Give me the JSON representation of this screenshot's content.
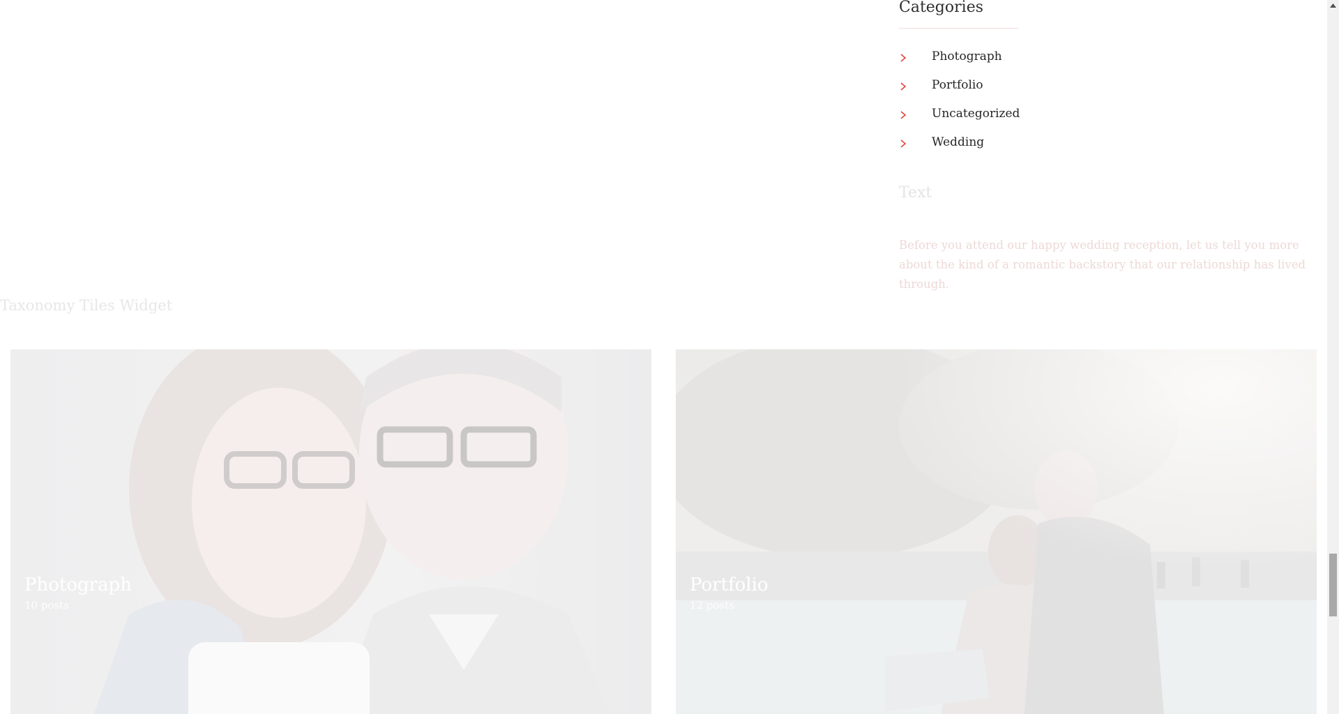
{
  "sidebar": {
    "categories_title": "Categories",
    "categories": [
      {
        "label": "Photograph"
      },
      {
        "label": "Portfolio"
      },
      {
        "label": "Uncategorized"
      },
      {
        "label": "Wedding"
      }
    ],
    "text_widget_title": "Text",
    "text_widget_body": "Before you attend our happy wedding reception, let us tell you more about the kind of a romantic backstory that our relationship has lived through."
  },
  "taxonomy": {
    "title": "Taxonomy Tiles Widget",
    "tiles": [
      {
        "name": "Photograph",
        "count": "10 posts"
      },
      {
        "name": "Portfolio",
        "count": "12 posts"
      }
    ]
  },
  "colors": {
    "accent": "#e0463f",
    "heading": "#2f2f2f",
    "link": "#262626",
    "scroll_thumb": "#a8a8a8"
  },
  "icons": {
    "category_bullet": "chevron-right-icon",
    "scroll_up": "arrow-up-icon"
  }
}
